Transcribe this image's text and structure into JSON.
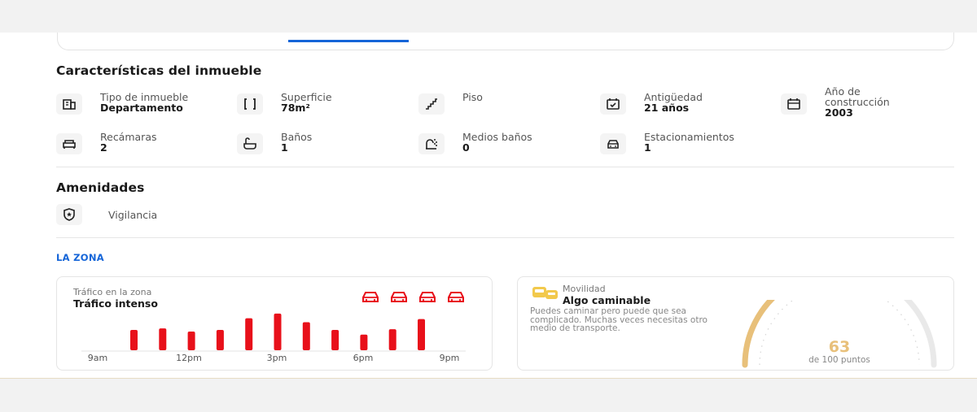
{
  "characteristics": {
    "title": "Características del inmueble",
    "items": [
      {
        "label": "Tipo de inmueble",
        "value": "Departamento",
        "icon": "building-icon"
      },
      {
        "label": "Superficie",
        "value": "78m²",
        "icon": "area-icon"
      },
      {
        "label": "Piso",
        "value": "",
        "icon": "stairs-icon"
      },
      {
        "label": "Antigüedad",
        "value": "21 años",
        "icon": "calendar-check-icon"
      },
      {
        "label": "Año de construcción",
        "value": "2003",
        "icon": "calendar-icon"
      },
      {
        "label": "Recámaras",
        "value": "2",
        "icon": "bed-icon"
      },
      {
        "label": "Baños",
        "value": "1",
        "icon": "bathtub-icon"
      },
      {
        "label": "Medios baños",
        "value": "0",
        "icon": "shower-icon"
      },
      {
        "label": "Estacionamientos",
        "value": "1",
        "icon": "car-icon"
      }
    ]
  },
  "amenities": {
    "title": "Amenidades",
    "items": [
      {
        "label": "Vigilancia",
        "icon": "shield-star-icon"
      }
    ]
  },
  "zone": {
    "title": "LA ZONA",
    "traffic": {
      "label": "Tráfico en la zona",
      "level": "Tráfico intenso",
      "car_icons": 4,
      "accent": "#e8101a"
    },
    "mobility": {
      "label": "Movilidad",
      "level": "Algo caminable",
      "description": "Puedes caminar pero puede que sea complicado. Muchas veces necesitas otro medio de transporte.",
      "score": "63",
      "score_caption": "de 100 puntos",
      "score_value": 63,
      "accent": "#e8c07a"
    }
  },
  "chart_data": {
    "type": "bar",
    "categories": [
      "9am",
      "10am",
      "11am",
      "12pm",
      "1pm",
      "2pm",
      "3pm",
      "4pm",
      "5pm",
      "6pm",
      "7pm",
      "8pm"
    ],
    "values": [
      26,
      28,
      24,
      26,
      41,
      47,
      36,
      26,
      20,
      27,
      40,
      0
    ],
    "tick_labels": [
      "9am",
      "12pm",
      "3pm",
      "6pm",
      "9pm"
    ],
    "ylim": [
      0,
      50
    ],
    "grid": false,
    "color": "#e8101a"
  }
}
